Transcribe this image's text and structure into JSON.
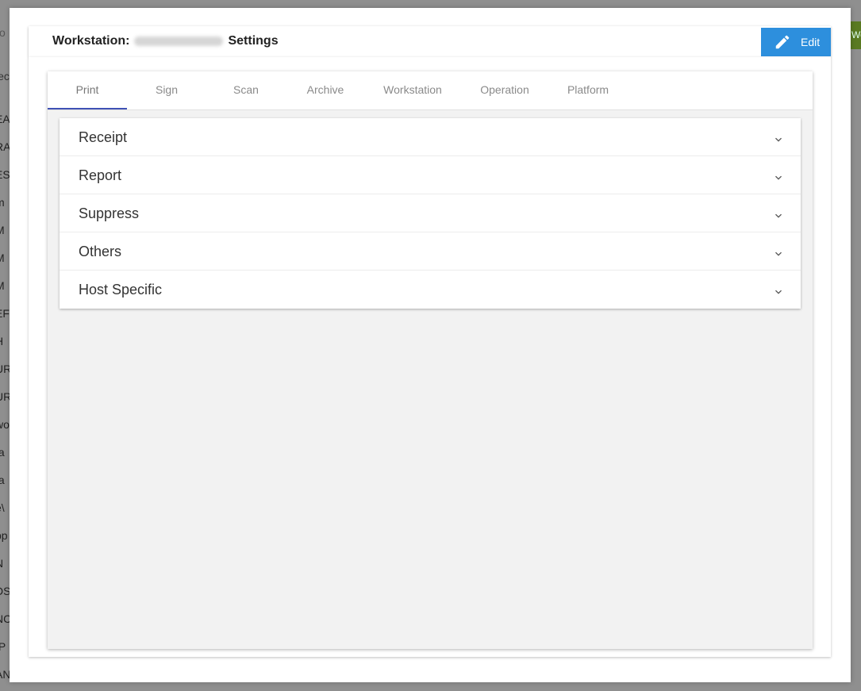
{
  "background": {
    "search_fragment": "Wo",
    "header_fragment": "lec",
    "rows": [
      "EAY",
      "RA",
      "ES",
      "m",
      "M",
      "M",
      "M",
      "EF",
      "H",
      "UR",
      "UR",
      "wo",
      "ta",
      "ta",
      "e\\",
      "pp",
      "N",
      "DS",
      "NC",
      "IP",
      "AN"
    ],
    "right_button_fragment": "Wo"
  },
  "dialog": {
    "title_prefix": "Workstation:",
    "title_suffix": "Settings",
    "edit_button": {
      "label": "Edit",
      "icon": "pencil-icon",
      "color": "#2d8fdd"
    }
  },
  "tabs": [
    {
      "label": "Print",
      "active": true
    },
    {
      "label": "Sign",
      "active": false
    },
    {
      "label": "Scan",
      "active": false
    },
    {
      "label": "Archive",
      "active": false
    },
    {
      "label": "Workstation",
      "active": false
    },
    {
      "label": "Operation",
      "active": false
    },
    {
      "label": "Platform",
      "active": false
    }
  ],
  "sections": [
    {
      "label": "Receipt",
      "icon": "chevron-down-icon"
    },
    {
      "label": "Report",
      "icon": "chevron-down-icon"
    },
    {
      "label": "Suppress",
      "icon": "chevron-down-icon"
    },
    {
      "label": "Others",
      "icon": "chevron-down-icon"
    },
    {
      "label": "Host Specific",
      "icon": "chevron-down-icon"
    }
  ],
  "colors": {
    "accent": "#3f51b5",
    "panel_bg": "#f2f2f2"
  }
}
